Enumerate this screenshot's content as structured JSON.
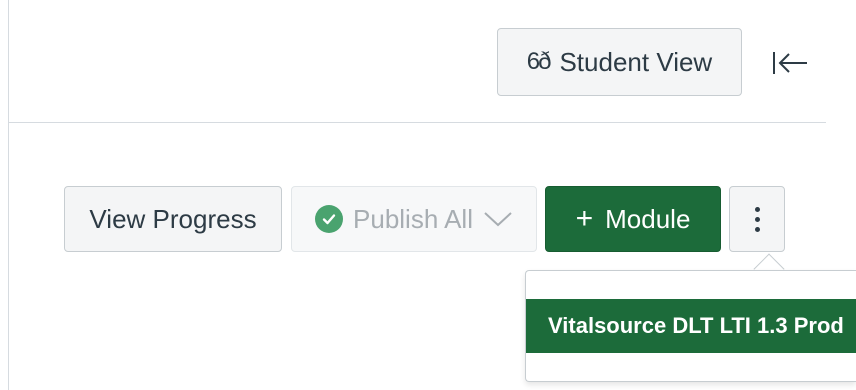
{
  "header": {
    "student_view": {
      "icon_text": "6ð",
      "icon_name": "eyes-icon",
      "label": "Student View"
    },
    "collapse": {
      "icon_name": "collapse-left-icon"
    }
  },
  "toolbar": {
    "view_progress_label": "View Progress",
    "publish_all": {
      "label": "Publish All",
      "icon_name": "check-circle-icon",
      "dropdown_icon_name": "chevron-down-icon"
    },
    "add_module": {
      "plus": "+",
      "label": "Module"
    },
    "more_options": {
      "icon_name": "kebab-vertical-icon"
    }
  },
  "menu": {
    "items": [
      {
        "label": "Vitalsource DLT LTI 1.3 Prod"
      }
    ]
  },
  "colors": {
    "primary_green": "#1c6b3a",
    "check_green": "#4aa36f",
    "text_dark": "#2d3b45",
    "disabled_text": "#a7adb2",
    "border": "#c7cdd1"
  }
}
